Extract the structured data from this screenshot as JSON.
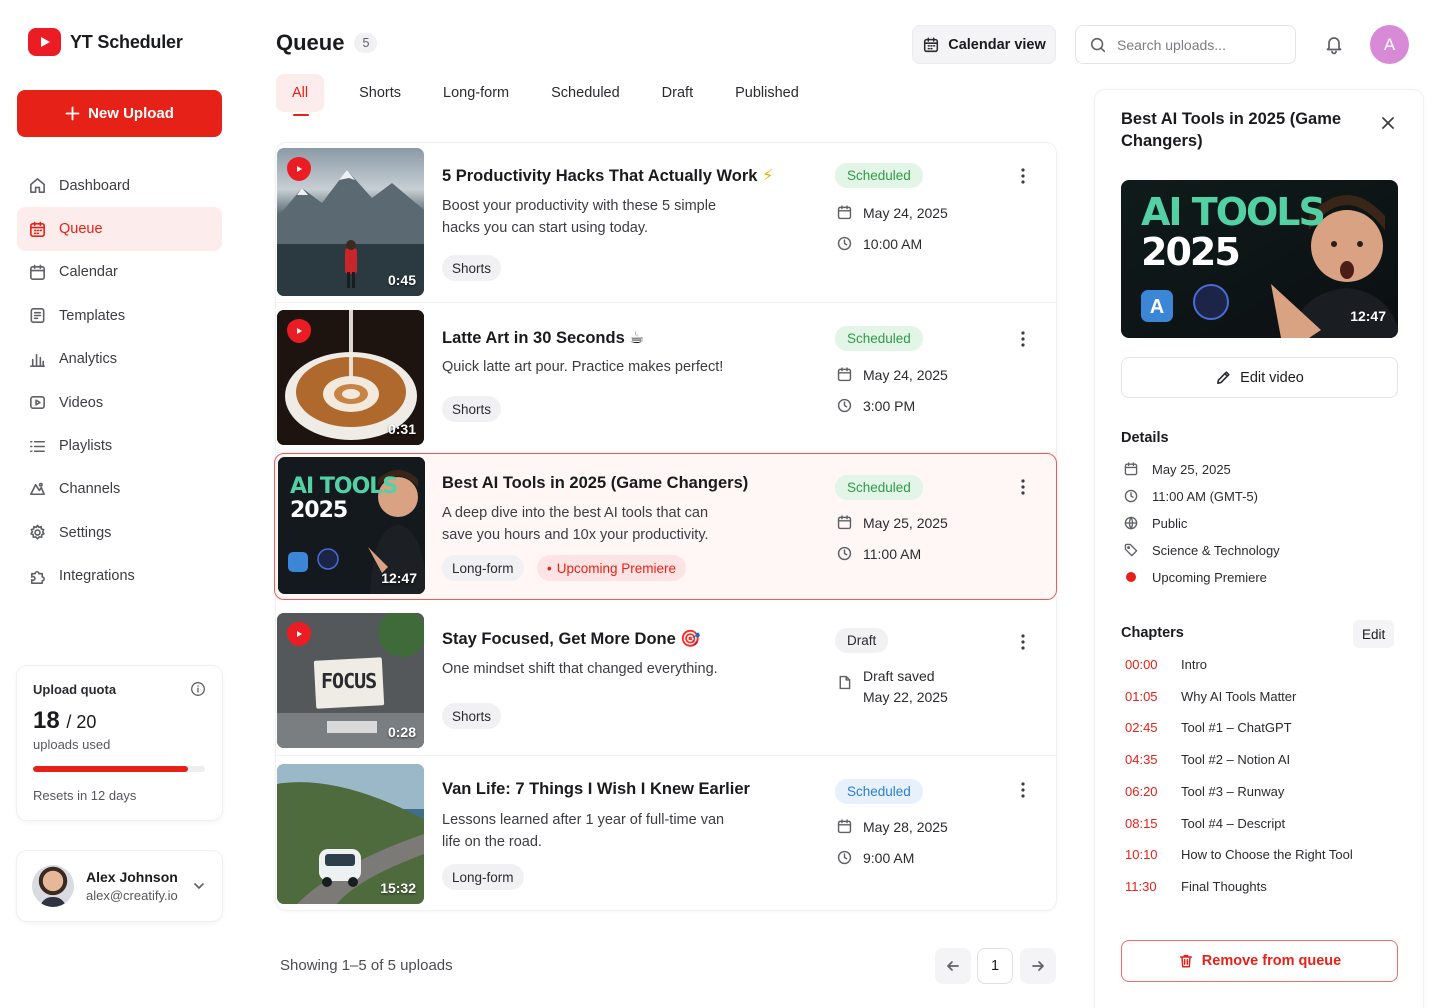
{
  "app": {
    "name": "YT Scheduler",
    "new_upload_label": "New Upload"
  },
  "nav": [
    {
      "label": "Dashboard",
      "icon": "home-icon",
      "active": false
    },
    {
      "label": "Queue",
      "icon": "calendar-grid-icon",
      "active": true
    },
    {
      "label": "Calendar",
      "icon": "calendar-icon",
      "active": false
    },
    {
      "label": "Templates",
      "icon": "template-icon",
      "active": false
    },
    {
      "label": "Analytics",
      "icon": "bar-chart-icon",
      "active": false
    },
    {
      "label": "Videos",
      "icon": "video-icon",
      "active": false
    },
    {
      "label": "Playlists",
      "icon": "list-icon",
      "active": false
    },
    {
      "label": "Channels",
      "icon": "channels-icon",
      "active": false
    },
    {
      "label": "Settings",
      "icon": "gear-icon",
      "active": false
    },
    {
      "label": "Integrations",
      "icon": "puzzle-icon",
      "active": false
    }
  ],
  "quota": {
    "title": "Upload quota",
    "used": "18",
    "total": "/ 20",
    "used_label": "uploads used",
    "used_fraction": 0.9,
    "reset": "Resets in 12 days"
  },
  "profile": {
    "name": "Alex Johnson",
    "email": "alex@creatify.io"
  },
  "header": {
    "title": "Queue",
    "count": "5",
    "calendar_view": "Calendar view",
    "search_placeholder": "Search uploads...",
    "avatar_letter": "A"
  },
  "tabs": [
    "All",
    "Shorts",
    "Long-form",
    "Scheduled",
    "Draft",
    "Published"
  ],
  "active_tab": "All",
  "rows": [
    {
      "title": "5 Productivity Hacks That Actually Work",
      "emoji": "⚡",
      "desc": "Boost your productivity with these 5 simple hacks you can start using today.",
      "tag": "Shorts",
      "duration": "0:45",
      "status": "Scheduled",
      "date": "May 24, 2025",
      "time": "10:00 AM"
    },
    {
      "title": "Latte Art in 30 Seconds",
      "emoji": "☕",
      "desc": "Quick latte art pour. Practice makes perfect!",
      "tag": "Shorts",
      "duration": "0:31",
      "status": "Scheduled",
      "date": "May 24, 2025",
      "time": "3:00 PM"
    },
    {
      "title": "Best AI Tools in 2025 (Game Changers)",
      "emoji": "",
      "desc": "A deep dive into the best AI tools that can save you hours and 10x your productivity.",
      "tag": "Long-form",
      "tag2": "Upcoming Premiere",
      "duration": "12:47",
      "status": "Scheduled",
      "date": "May 25, 2025",
      "time": "11:00 AM",
      "thumb_text": "AI TOOLS 2025"
    },
    {
      "title": "Stay Focused, Get More Done",
      "emoji": "🎯",
      "desc": "One mindset shift that changed everything.",
      "tag": "Shorts",
      "duration": "0:28",
      "status": "Draft",
      "draft_label": "Draft saved",
      "date": "May 22, 2025",
      "thumb_text": "FOCUS"
    },
    {
      "title": "Van Life: 7 Things I Wish I Knew Earlier",
      "emoji": "",
      "desc": "Lessons learned after 1 year of full-time van life on the road.",
      "tag": "Long-form",
      "duration": "15:32",
      "status": "Scheduled",
      "date": "May 28, 2025",
      "time": "9:00 AM"
    }
  ],
  "footer": {
    "showing": "Showing 1–5 of 5 uploads",
    "page": "1"
  },
  "panel": {
    "title": "Best AI Tools in 2025 (Game Changers)",
    "thumb_line1": "AI TOOLS",
    "thumb_line2": "2025",
    "duration": "12:47",
    "edit_label": "Edit video",
    "details_title": "Details",
    "details": [
      {
        "icon": "calendar-icon",
        "text": "May 25, 2025"
      },
      {
        "icon": "clock-icon",
        "text": "11:00 AM (GMT-5)"
      },
      {
        "icon": "globe-icon",
        "text": "Public"
      },
      {
        "icon": "tag-icon",
        "text": "Science & Technology"
      },
      {
        "icon": "red-dot-icon",
        "text": "Upcoming Premiere"
      }
    ],
    "chapters_title": "Chapters",
    "chapters_edit": "Edit",
    "chapters": [
      {
        "time": "00:00",
        "name": "Intro"
      },
      {
        "time": "01:05",
        "name": "Why AI Tools Matter"
      },
      {
        "time": "02:45",
        "name": "Tool #1 – ChatGPT"
      },
      {
        "time": "04:35",
        "name": "Tool #2 – Notion AI"
      },
      {
        "time": "06:20",
        "name": "Tool #3 – Runway"
      },
      {
        "time": "08:15",
        "name": "Tool #4 – Descript"
      },
      {
        "time": "10:10",
        "name": "How to Choose the Right Tool"
      },
      {
        "time": "11:30",
        "name": "Final Thoughts"
      }
    ],
    "remove_label": "Remove from queue"
  },
  "colors": {
    "accent": "#e62117",
    "scheduled": "#2f9a48",
    "scheduled_blue": "#2a7ed3"
  }
}
